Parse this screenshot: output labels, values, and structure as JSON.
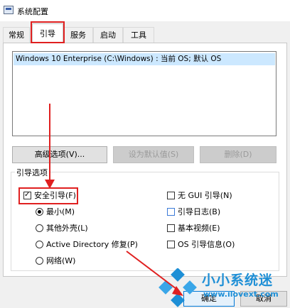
{
  "window": {
    "title": "系统配置",
    "icon": "msconfig-icon"
  },
  "tabs": [
    {
      "label": "常规",
      "active": false
    },
    {
      "label": "引导",
      "active": true
    },
    {
      "label": "服务",
      "active": false
    },
    {
      "label": "启动",
      "active": false
    },
    {
      "label": "工具",
      "active": false
    }
  ],
  "boot_list": {
    "entries": [
      "Windows 10 Enterprise (C:\\Windows) : 当前 OS; 默认 OS"
    ],
    "selected_index": 0
  },
  "buttons": {
    "advanced": "高级选项(V)...",
    "set_default": "设为默认值(S)",
    "delete": "删除(D)",
    "ok": "确定",
    "cancel": "取消"
  },
  "boot_options": {
    "legend": "引导选项",
    "safe_boot": {
      "label": "安全引导(F)",
      "checked": true
    },
    "radios": [
      {
        "label": "最小(M)",
        "checked": true
      },
      {
        "label": "其他外壳(L)",
        "checked": false
      },
      {
        "label": "Active Directory 修复(P)",
        "checked": false
      },
      {
        "label": "网络(W)",
        "checked": false
      }
    ],
    "right_options": [
      {
        "label": "无 GUI 引导(N)",
        "checked": false
      },
      {
        "label": "引导日志(B)",
        "checked": false
      },
      {
        "label": "基本视频(E)",
        "checked": false
      },
      {
        "label": "OS 引导信息(O)",
        "checked": false
      }
    ]
  },
  "watermark": {
    "title": "小小系统迷",
    "url": "www.ilovext.com"
  },
  "colors": {
    "highlight": "#e02020",
    "selection": "#cce8ff",
    "watermark": "#1e8fd6"
  }
}
